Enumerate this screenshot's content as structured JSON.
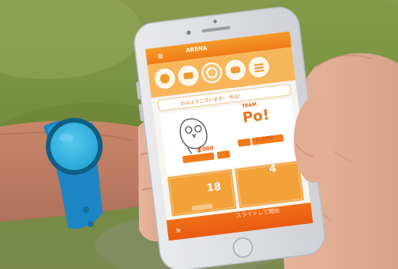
{
  "app": {
    "logo": "ARENA",
    "greeting": "おはようございます！ 昨日！",
    "team_label": "TEAM",
    "team_name": "Po!",
    "swipe_label": "スライドして開始"
  },
  "stats": {
    "my_steps": "3,000",
    "opponent_steps": "3,900",
    "days_left": "18",
    "rank": "4"
  },
  "tabs": [
    "person-icon",
    "group-icon",
    "ring-icon",
    "chat-icon",
    "menu-icon"
  ],
  "colors": {
    "accent": "#f28a1c",
    "accent_dark": "#e56512",
    "panel": "#fdfdfb",
    "wristband": "#1f8fcf",
    "tracker_face": "#33b7e6",
    "background_grass": "#7d9340"
  }
}
